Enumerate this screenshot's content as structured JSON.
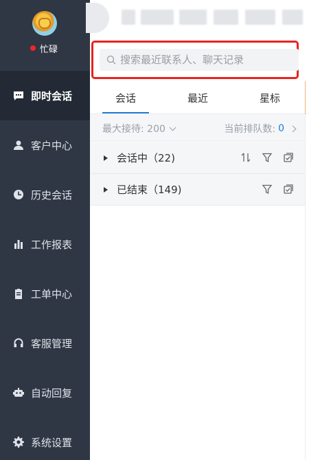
{
  "profile": {
    "status_text": "忙碌",
    "status_color": "#f5222d"
  },
  "sidebar": {
    "items": [
      {
        "label": "即时会话",
        "icon": "chat-icon",
        "active": true
      },
      {
        "label": "客户中心",
        "icon": "user-icon"
      },
      {
        "label": "历史会话",
        "icon": "clock-icon"
      },
      {
        "label": "工作报表",
        "icon": "bar-chart-icon"
      },
      {
        "label": "工单中心",
        "icon": "clipboard-icon"
      },
      {
        "label": "客服管理",
        "icon": "headset-icon"
      },
      {
        "label": "自动回复",
        "icon": "robot-icon"
      },
      {
        "label": "系统设置",
        "icon": "gear-icon"
      }
    ]
  },
  "search": {
    "placeholder": "搜索最近联系人、聊天记录"
  },
  "tabs": [
    {
      "label": "会话",
      "active": true
    },
    {
      "label": "最近"
    },
    {
      "label": "星标"
    }
  ],
  "stats": {
    "max_label": "最大接待: 200",
    "queue_label": "当前排队数:",
    "queue_value": "0"
  },
  "groups": [
    {
      "label": "会话中（22)"
    },
    {
      "label": "已结束（149)"
    }
  ],
  "colors": {
    "sidebar_bg": "#2f3744",
    "accent": "#1f7ad8",
    "highlight_border": "#e8231c"
  }
}
